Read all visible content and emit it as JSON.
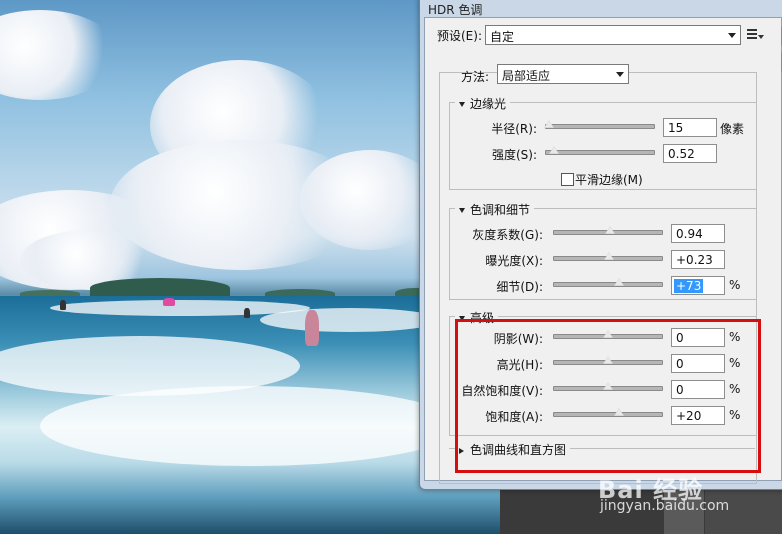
{
  "dialog": {
    "title": "HDR 色调",
    "preset_label": "预设(E):",
    "preset_value": "自定",
    "preset_menu_icon": "list-menu-icon",
    "method_label": "方法:",
    "method_value": "局部适应"
  },
  "edge_glow": {
    "legend": "边缘光",
    "radius_label": "半径(R):",
    "radius_value": "15",
    "radius_unit": "像素",
    "radius_level": 0.03,
    "strength_label": "强度(S):",
    "strength_value": "0.52",
    "strength_level": 0.07,
    "smooth_edges_label": "平滑边缘(M)",
    "smooth_edges_checked": false
  },
  "tone_detail": {
    "legend": "色调和细节",
    "gamma_label": "灰度系数(G):",
    "gamma_value": "0.94",
    "gamma_level": 0.52,
    "exposure_label": "曝光度(X):",
    "exposure_value": "+0.23",
    "exposure_level": 0.51,
    "detail_label": "细节(D):",
    "detail_value": "+73",
    "detail_unit": "%",
    "detail_level": 0.6
  },
  "advanced": {
    "legend": "高级",
    "shadow_label": "阴影(W):",
    "shadow_value": "0",
    "shadow_unit": "%",
    "shadow_level": 0.5,
    "highlight_label": "高光(H):",
    "highlight_value": "0",
    "highlight_unit": "%",
    "highlight_level": 0.5,
    "vibrance_label": "自然饱和度(V):",
    "vibrance_value": "0",
    "vibrance_unit": "%",
    "vibrance_level": 0.5,
    "saturation_label": "饱和度(A):",
    "saturation_value": "+20",
    "saturation_unit": "%",
    "saturation_level": 0.6
  },
  "curve": {
    "legend": "色调曲线和直方图"
  },
  "watermark": {
    "line1": "Bai 经验",
    "line2": "jingyan.baidu.com"
  },
  "colors": {
    "highlight_box": "#d50f0f",
    "selection": "#3399ff"
  }
}
